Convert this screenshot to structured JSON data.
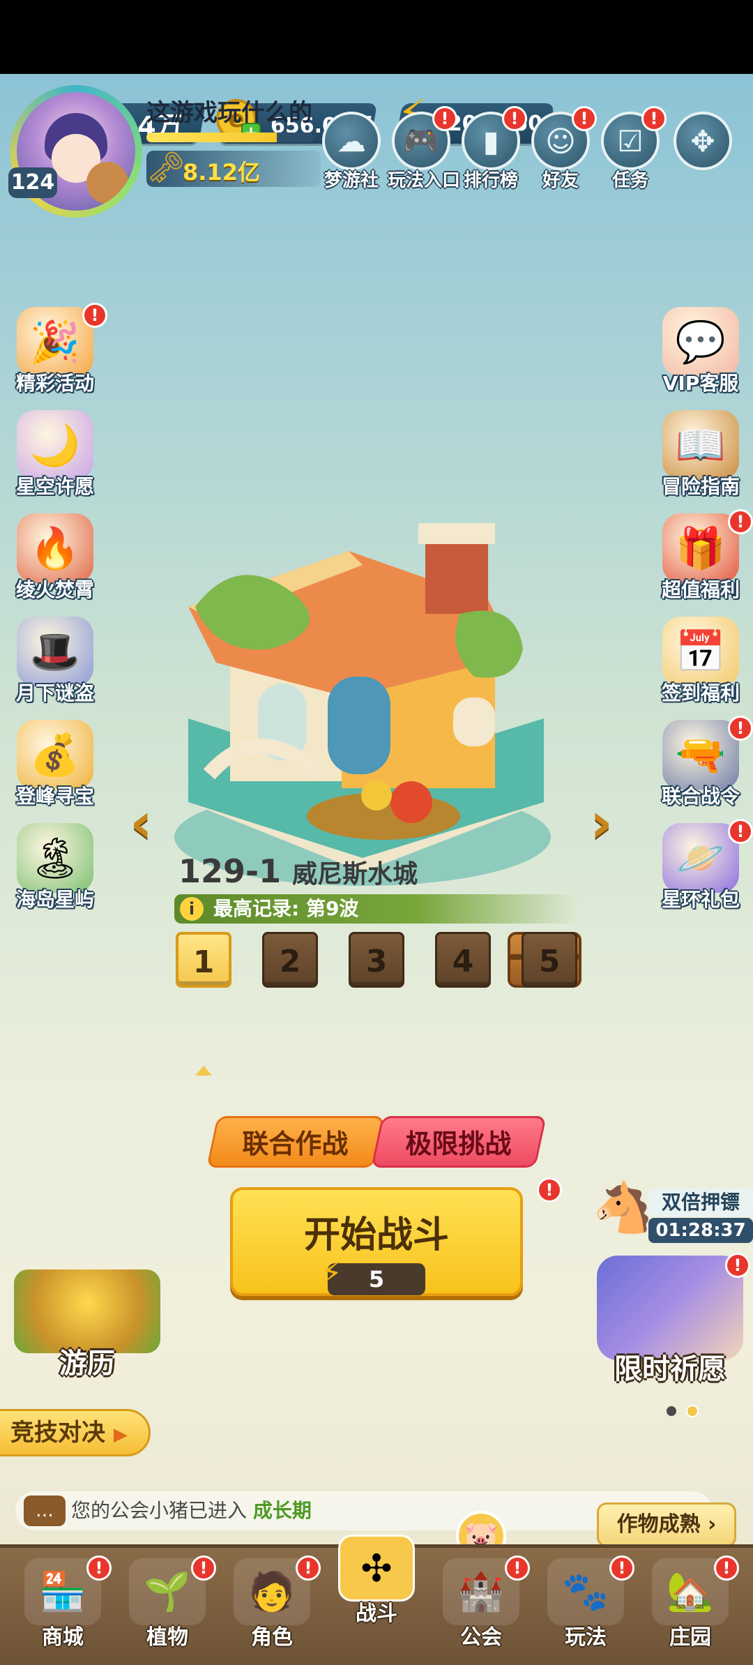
{
  "currencies": [
    {
      "name": "diamond",
      "icon": "diamond-icon",
      "glyph": "💎",
      "value": "1.14万"
    },
    {
      "name": "coin",
      "icon": "coin-icon",
      "glyph": "🪙",
      "value": "656.07万"
    },
    {
      "name": "energy",
      "icon": "lightning-icon",
      "glyph": "⚡",
      "value": "2063/50"
    }
  ],
  "player": {
    "level": "124",
    "name": "这游戏玩什么的",
    "power": "8.12亿",
    "xp_progress": 0.78
  },
  "top_buttons": [
    {
      "label": "梦游社",
      "icon": "club-icon",
      "glyph": "☁",
      "alert": false
    },
    {
      "label": "玩法入口",
      "icon": "gamepad-icon",
      "glyph": "🎮",
      "alert": true
    },
    {
      "label": "排行榜",
      "icon": "ranking-icon",
      "glyph": "▮",
      "alert": true
    },
    {
      "label": "好友",
      "icon": "friends-icon",
      "glyph": "☺",
      "alert": true
    },
    {
      "label": "任务",
      "icon": "task-icon",
      "glyph": "☑",
      "alert": true
    },
    {
      "label": "",
      "icon": "more-icon",
      "glyph": "✥",
      "alert": false
    }
  ],
  "left_menu": [
    {
      "label": "精彩活动",
      "icon": "events-icon",
      "glyph": "🎉",
      "alert": true
    },
    {
      "label": "星空许愿",
      "icon": "wish-icon",
      "glyph": "🌙",
      "alert": false
    },
    {
      "label": "绫火焚霄",
      "icon": "heroes-icon",
      "glyph": "🔥",
      "alert": false
    },
    {
      "label": "月下谜盗",
      "icon": "thief-icon",
      "glyph": "🎩",
      "alert": false
    },
    {
      "label": "登峰寻宝",
      "icon": "treasure-icon",
      "glyph": "💰",
      "alert": false
    },
    {
      "label": "海岛星屿",
      "icon": "island-icon",
      "glyph": "🏝",
      "alert": false
    }
  ],
  "right_menu": [
    {
      "label": "VIP客服",
      "icon": "support-icon",
      "glyph": "💬",
      "alert": false
    },
    {
      "label": "冒险指南",
      "icon": "guide-icon",
      "glyph": "📖",
      "alert": false
    },
    {
      "label": "超值福利",
      "icon": "gift-icon",
      "glyph": "🎁",
      "alert": true
    },
    {
      "label": "签到福利",
      "icon": "calendar-icon",
      "glyph": "📅",
      "alert": false
    },
    {
      "label": "联合战令",
      "icon": "battlepass-icon",
      "glyph": "🔫",
      "alert": true
    },
    {
      "label": "星环礼包",
      "icon": "package-icon",
      "glyph": "🪐",
      "alert": true
    }
  ],
  "stage": {
    "number": "129-1",
    "name": "威尼斯水城",
    "record": "最高记录: 第9波",
    "waves": [
      "1",
      "2",
      "3",
      "4",
      "5"
    ],
    "active_wave": "1"
  },
  "modes": {
    "coop": "联合作战",
    "challenge": "极限挑战"
  },
  "start_button": {
    "label": "开始战斗",
    "cost": "5"
  },
  "escort": {
    "label": "双倍押镖",
    "timer": "01:28:37"
  },
  "cards": {
    "travel": "游历",
    "limited_wish": "限时祈愿",
    "arena": "竞技对决"
  },
  "notice": {
    "text": "您的公会小猪已进入 ",
    "highlight": "成长期"
  },
  "crop_ready": "作物成熟",
  "nav": [
    {
      "label": "商城",
      "icon": "shop-icon",
      "glyph": "🏪",
      "alert": true,
      "active": false
    },
    {
      "label": "植物",
      "icon": "plant-icon",
      "glyph": "🌱",
      "alert": true,
      "active": false
    },
    {
      "label": "角色",
      "icon": "character-icon",
      "glyph": "🧑",
      "alert": true,
      "active": false
    },
    {
      "label": "战斗",
      "icon": "windmill-icon",
      "glyph": "✣",
      "alert": false,
      "active": true
    },
    {
      "label": "公会",
      "icon": "guild-icon",
      "glyph": "🏰",
      "alert": true,
      "active": false
    },
    {
      "label": "玩法",
      "icon": "play-icon",
      "glyph": "🐾",
      "alert": true,
      "active": false
    },
    {
      "label": "庄园",
      "icon": "manor-icon",
      "glyph": "🏡",
      "alert": true,
      "active": false
    }
  ]
}
